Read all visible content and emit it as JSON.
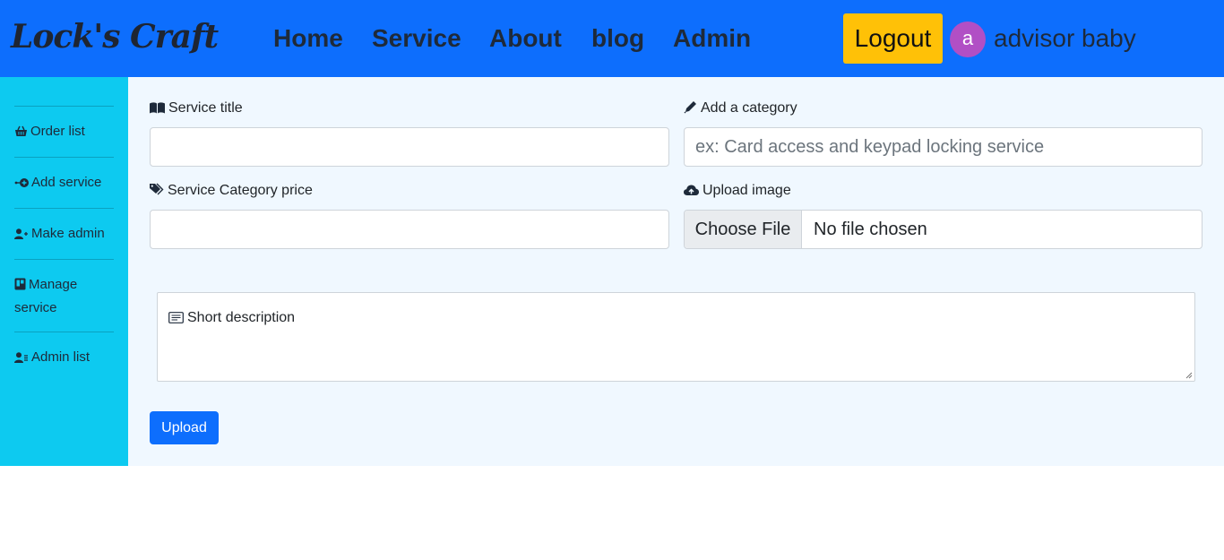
{
  "header": {
    "brand": "Lock's Craft",
    "nav": [
      "Home",
      "Service",
      "About",
      "blog",
      "Admin"
    ],
    "logout_label": "Logout",
    "avatar_initial": "a",
    "username": "advisor baby"
  },
  "sidebar": {
    "items": [
      {
        "label": "Order list",
        "icon": "basket-icon"
      },
      {
        "label": "Add service",
        "icon": "add-circle-icon"
      },
      {
        "label": "Make admin",
        "icon": "user-plus-icon"
      },
      {
        "label": "Manage service",
        "icon": "clipboard-icon"
      },
      {
        "label": "Admin list",
        "icon": "user-list-icon"
      }
    ]
  },
  "form": {
    "service_title_label": "Service title",
    "service_title_value": "",
    "category_label": "Add a category",
    "category_placeholder": "ex: Card access and keypad locking service",
    "price_label": "Service Category price",
    "price_value": "",
    "upload_image_label": "Upload image",
    "choose_file_label": "Choose File",
    "file_status": "No file chosen",
    "description_label": "Short description",
    "upload_button": "Upload"
  },
  "colors": {
    "navbar": "#0d6efd",
    "sidebar": "#0dcaf0",
    "main_bg": "#f0f8ff",
    "logout": "#ffc107",
    "avatar": "#b14fc5",
    "upload_button": "#0d6efd"
  }
}
